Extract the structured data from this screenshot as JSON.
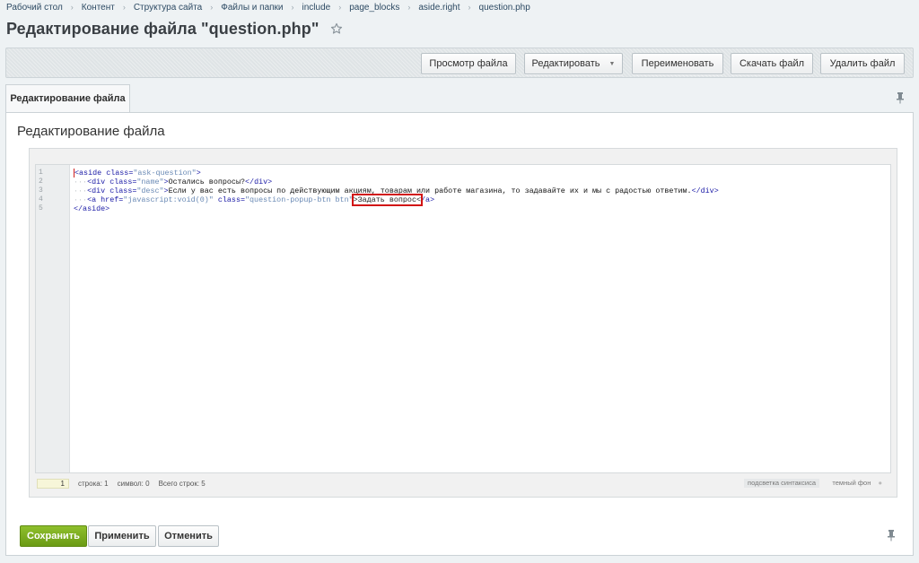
{
  "breadcrumb": [
    "Рабочий стол",
    "Контент",
    "Структура сайта",
    "Файлы и папки",
    "include",
    "page_blocks",
    "aside.right",
    "question.php"
  ],
  "page_title": "Редактирование файла \"question.php\"",
  "toolbar": {
    "view_file": "Просмотр файла",
    "edit": "Редактировать",
    "rename": "Переименовать",
    "download": "Скачать файл",
    "delete": "Удалить файл"
  },
  "tab": {
    "label": "Редактирование файла"
  },
  "panel": {
    "title": "Редактирование файла"
  },
  "editor": {
    "line_numbers": [
      "1",
      "2",
      "3",
      "4",
      "5"
    ],
    "lines": [
      [
        {
          "t": "<aside ",
          "c": "tag"
        },
        {
          "t": "class=",
          "c": "attr"
        },
        {
          "t": "\"ask-question\"",
          "c": "str"
        },
        {
          "t": ">",
          "c": "tag"
        }
      ],
      [
        {
          "t": "···",
          "c": "dots"
        },
        {
          "t": "<div ",
          "c": "tag"
        },
        {
          "t": "class=",
          "c": "attr"
        },
        {
          "t": "\"name\"",
          "c": "str"
        },
        {
          "t": ">",
          "c": "tag"
        },
        {
          "t": "Остались вопросы?",
          "c": "txt"
        },
        {
          "t": "</div>",
          "c": "tag"
        }
      ],
      [
        {
          "t": "···",
          "c": "dots"
        },
        {
          "t": "<div ",
          "c": "tag"
        },
        {
          "t": "class=",
          "c": "attr"
        },
        {
          "t": "\"desc\"",
          "c": "str"
        },
        {
          "t": ">",
          "c": "tag"
        },
        {
          "t": "Если у вас есть вопросы по действующим акциям, товарам или работе магазина, то задавайте их и мы с радостью ответим.",
          "c": "txt"
        },
        {
          "t": "</div>",
          "c": "tag"
        }
      ],
      [
        {
          "t": "···",
          "c": "dots"
        },
        {
          "t": "<a ",
          "c": "tag"
        },
        {
          "t": "href=",
          "c": "attr"
        },
        {
          "t": "\"javascript:void(0)\" ",
          "c": "str"
        },
        {
          "t": "class=",
          "c": "attr"
        },
        {
          "t": "\"question-popup-btn btn\"",
          "c": "str"
        },
        {
          "t": ">Задать вопрос<",
          "c": "hl"
        },
        {
          "t": "/a>",
          "c": "tag"
        }
      ],
      [
        {
          "t": "</aside>",
          "c": "tag"
        }
      ]
    ],
    "status": {
      "line_value": "1",
      "row": "строка: 1",
      "symbol": "символ: 0",
      "total": "Всего строк: 5",
      "syntax": "подсветка синтаксиса",
      "theme": "темный фон"
    }
  },
  "footer": {
    "save": "Сохранить",
    "apply": "Применить",
    "cancel": "Отменить"
  }
}
